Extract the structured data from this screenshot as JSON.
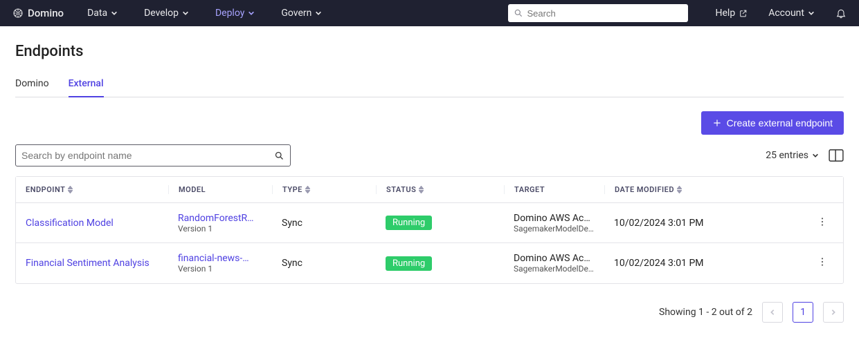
{
  "brand": "Domino",
  "nav": {
    "items": [
      {
        "label": "Data",
        "active": false
      },
      {
        "label": "Develop",
        "active": false
      },
      {
        "label": "Deploy",
        "active": true
      },
      {
        "label": "Govern",
        "active": false
      }
    ]
  },
  "top_search": {
    "placeholder": "Search"
  },
  "help": {
    "label": "Help"
  },
  "account": {
    "label": "Account"
  },
  "page_title": "Endpoints",
  "tabs": [
    {
      "label": "Domino",
      "active": false
    },
    {
      "label": "External",
      "active": true
    }
  ],
  "create_button": {
    "label": "Create external endpoint"
  },
  "endpoint_search": {
    "placeholder": "Search by endpoint name"
  },
  "entries_selector": {
    "label": "25 entries"
  },
  "table": {
    "columns": [
      {
        "label": "ENDPOINT",
        "sortable": true
      },
      {
        "label": "MODEL",
        "sortable": false
      },
      {
        "label": "TYPE",
        "sortable": true
      },
      {
        "label": "STATUS",
        "sortable": true
      },
      {
        "label": "TARGET",
        "sortable": false
      },
      {
        "label": "DATE MODIFIED",
        "sortable": true
      },
      {
        "label": "",
        "sortable": false
      }
    ],
    "rows": [
      {
        "endpoint": "Classification Model",
        "model": "RandomForestR…",
        "version": "Version 1",
        "type": "Sync",
        "status": "Running",
        "target_main": "Domino AWS Acc…",
        "target_sub": "SagemakerModelDe…",
        "date_modified": "10/02/2024 3:01 PM"
      },
      {
        "endpoint": "Financial Sentiment Analysis",
        "model": "financial-news-…",
        "version": "Version 1",
        "type": "Sync",
        "status": "Running",
        "target_main": "Domino AWS Acc…",
        "target_sub": "SagemakerModelDe…",
        "date_modified": "10/02/2024 3:01 PM"
      }
    ]
  },
  "pagination": {
    "summary": "Showing 1 - 2 out of 2",
    "current_page": "1"
  }
}
